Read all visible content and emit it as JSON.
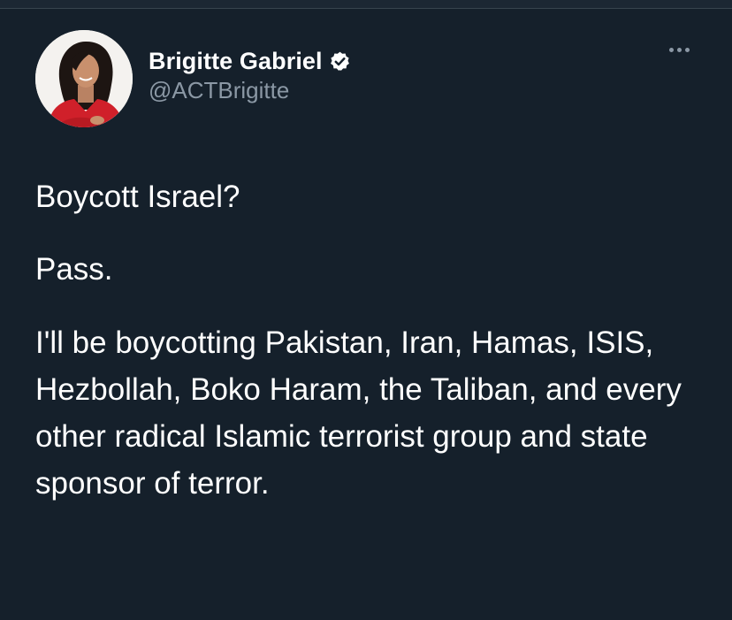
{
  "tweet": {
    "author": {
      "display_name": "Brigitte Gabriel",
      "handle": "@ACTBrigitte",
      "verified_icon": "verified-badge-icon",
      "avatar_icon": "profile-photo"
    },
    "more_icon": "more-options-icon",
    "paragraphs": [
      "Boycott Israel?",
      "Pass.",
      "I'll be boycotting Pakistan, Iran, Hamas, ISIS, Hezbollah, Boko Haram, the Taliban, and every other radical Islamic terrorist group and state sponsor of terror."
    ]
  },
  "colors": {
    "background": "#15202b",
    "text": "#ffffff",
    "secondary_text": "#8b98a5"
  }
}
